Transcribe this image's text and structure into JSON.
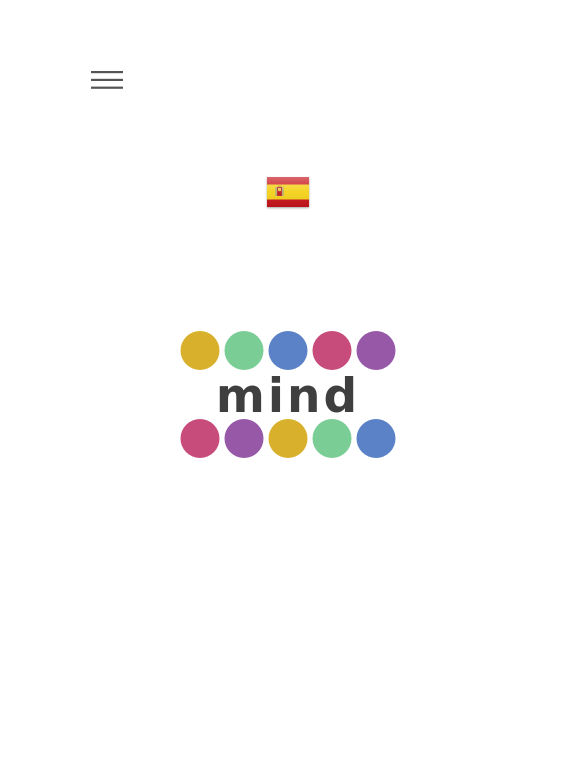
{
  "menu": {
    "icon": "hamburger-menu-icon",
    "color": "#555555"
  },
  "language": {
    "icon": "spain-flag-icon",
    "colors": {
      "red": "#c8141c",
      "yellow": "#f4d21a"
    }
  },
  "logo": {
    "text": "mind",
    "text_color": "#3f3f3f",
    "top_dots": [
      "#d8b02c",
      "#79cd95",
      "#5b82c6",
      "#c74c7b",
      "#9658a7"
    ],
    "bottom_dots": [
      "#c74c7b",
      "#9658a7",
      "#d8b02c",
      "#79cd95",
      "#5b82c6"
    ]
  }
}
